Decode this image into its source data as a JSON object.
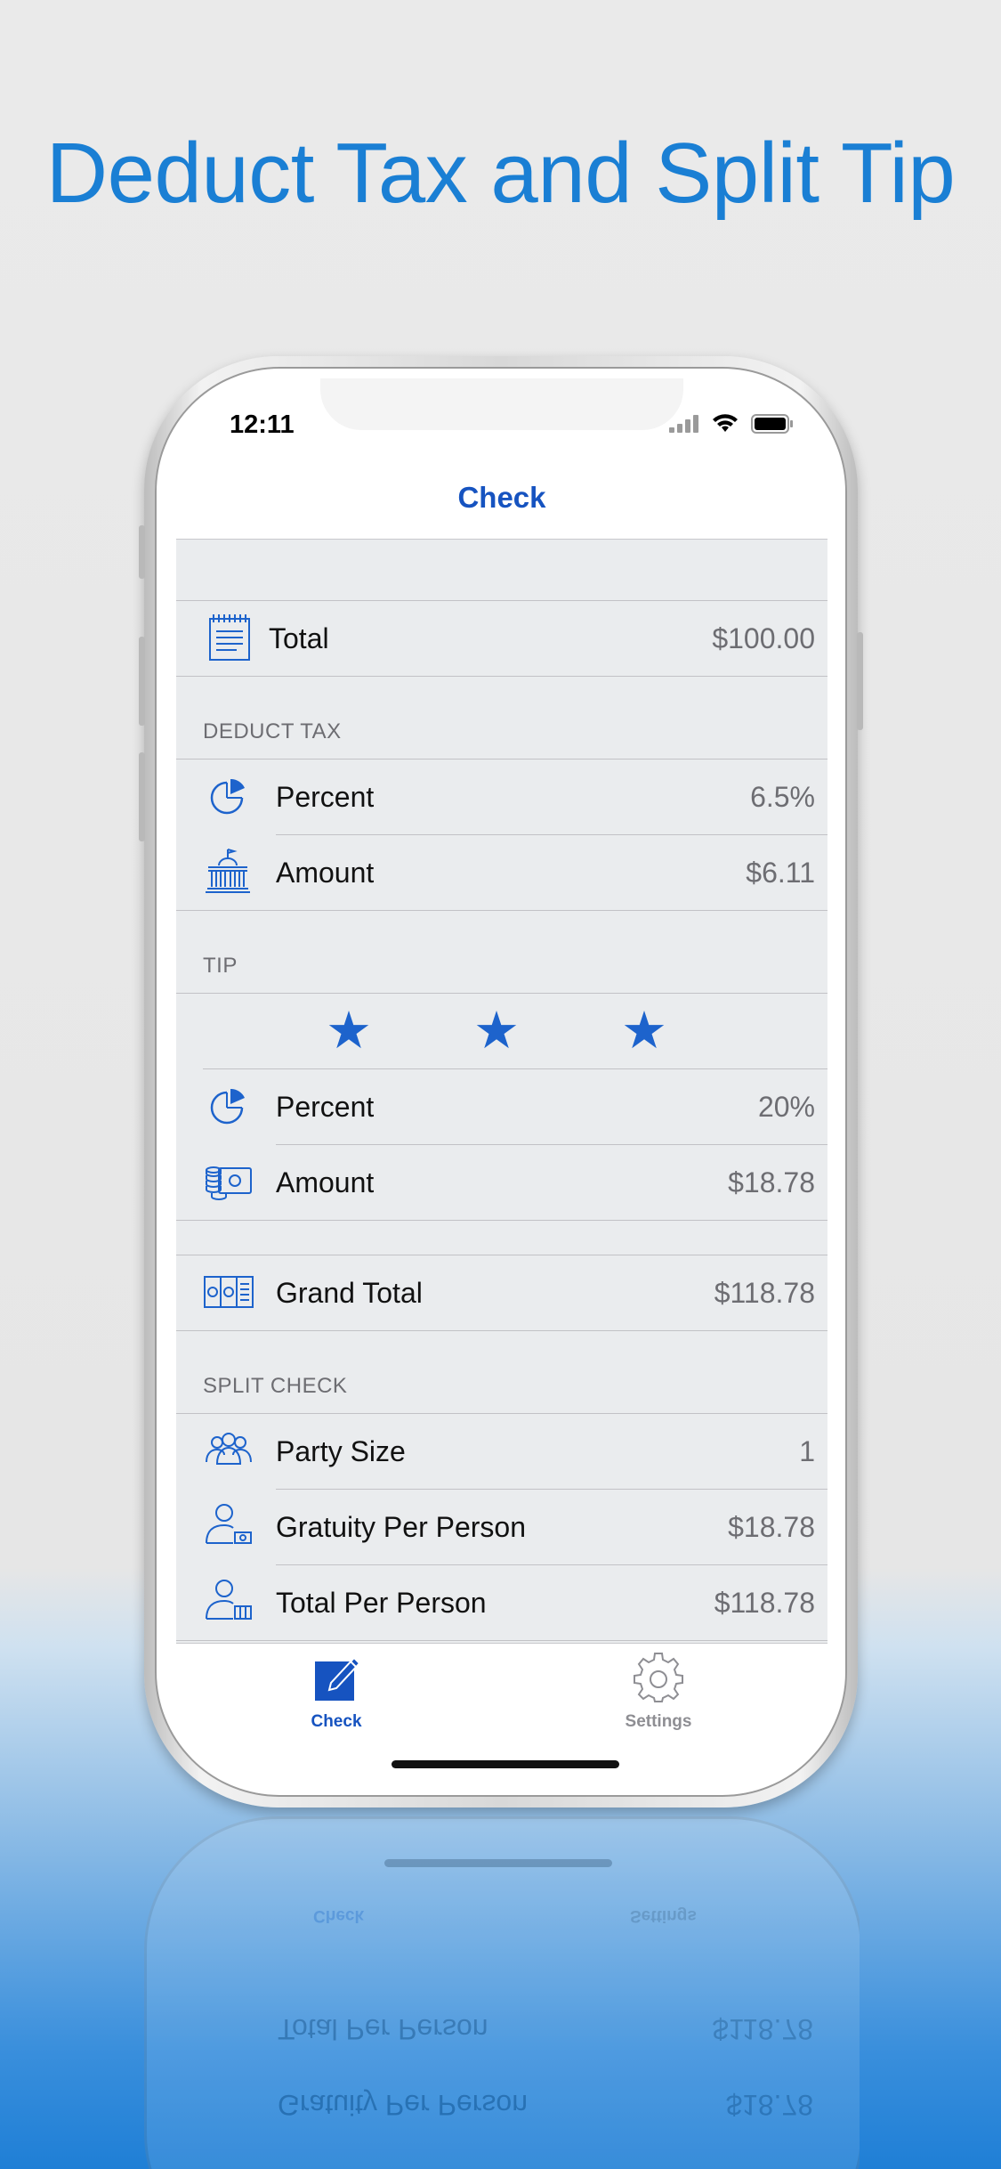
{
  "headline": "Deduct Tax and Split Tip",
  "status_bar": {
    "time": "12:11"
  },
  "nav": {
    "title": "Check"
  },
  "total": {
    "label": "Total",
    "value": "$100.00"
  },
  "deduct_tax": {
    "header": "DEDUCT TAX",
    "percent": {
      "label": "Percent",
      "value": "6.5%"
    },
    "amount": {
      "label": "Amount",
      "value": "$6.11"
    }
  },
  "tip": {
    "header": "TIP",
    "stars": 3,
    "percent": {
      "label": "Percent",
      "value": "20%"
    },
    "amount": {
      "label": "Amount",
      "value": "$18.78"
    }
  },
  "grand_total": {
    "label": "Grand Total",
    "value": "$118.78"
  },
  "split_check": {
    "header": "SPLIT CHECK",
    "party_size": {
      "label": "Party Size",
      "value": "1"
    },
    "gratuity_per_person": {
      "label": "Gratuity Per Person",
      "value": "$18.78"
    },
    "total_per_person": {
      "label": "Total Per Person",
      "value": "$118.78"
    }
  },
  "tabbar": {
    "check": {
      "label": "Check",
      "color": "#1653c0"
    },
    "settings": {
      "label": "Settings",
      "color": "#8e8e93"
    }
  },
  "reflection": {
    "check": "Check",
    "settings": "Settings",
    "total_per_person": "Total Per Person",
    "total_per_person_value": "$118.78",
    "gratuity_per_person": "Gratuity Per Person",
    "gratuity_per_person_value": "$18.78"
  },
  "colors": {
    "accent": "#1653c0",
    "icon_blue": "#1d63cc",
    "headline": "#1a7fd4"
  }
}
